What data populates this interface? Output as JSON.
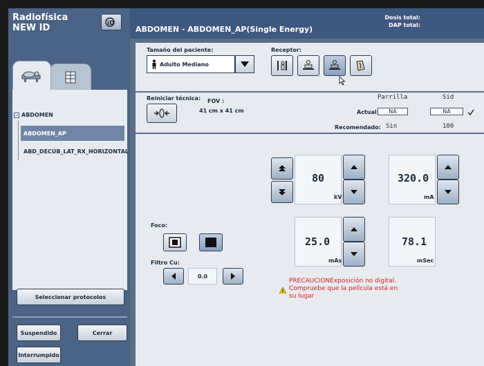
{
  "app": {
    "title_line1": "Radiofísica",
    "title_line2": "NEW ID"
  },
  "header": {
    "title": "ABDOMEN - ABDOMEN_AP(Single Energy)",
    "dose_total": "Dosis total:",
    "dap_total": "DAP total:"
  },
  "sidebar": {
    "protocol_group": "ABDOMEN",
    "items": [
      {
        "label": "ABDOMEN_AP",
        "selected": true
      },
      {
        "label": "ABD_DECÚB_LAT_RX_HORIZONTAL",
        "selected": false
      }
    ],
    "select_protocols": "Seleccionar protocolos",
    "suspend": "Suspendido",
    "close": "Cerrar",
    "interrupted": "Interrumpido"
  },
  "patient": {
    "size_label": "Tamaño del paciente:",
    "size_value": "Adulto Mediano",
    "receptor_label": "Receptor:"
  },
  "technique": {
    "reset_label": "Reiniciar técnica:",
    "fov_label": "FOV :",
    "fov_value": "41 cm x 41 cm",
    "grid_header": "Parrilla",
    "sid_header": "Sid",
    "actual_label": "Actual:",
    "recommended_label": "Recomendado:",
    "grid_actual": "NA",
    "sid_actual": "NA",
    "grid_recommended": "Sin",
    "sid_recommended": "100"
  },
  "exposure": {
    "kv_value": "80",
    "kv_unit": "kV",
    "ma_value": "320.0",
    "ma_unit": "mA",
    "mas_value": "25.0",
    "mas_unit": "mAs",
    "msec_value": "78.1",
    "msec_unit": "mSec",
    "focus_label": "Foco:",
    "filter_label": "Filtro Cu:",
    "filter_value": "0.0"
  },
  "warning": {
    "line1": "PRECAUCIONExposición no digital.",
    "line2": "Compruebe que la película está en",
    "line3": "su lugar"
  },
  "colors": {
    "warning_red": "#d71c1c",
    "header_blue": "#3f5880",
    "panel_bg": "#e7ebf0"
  }
}
